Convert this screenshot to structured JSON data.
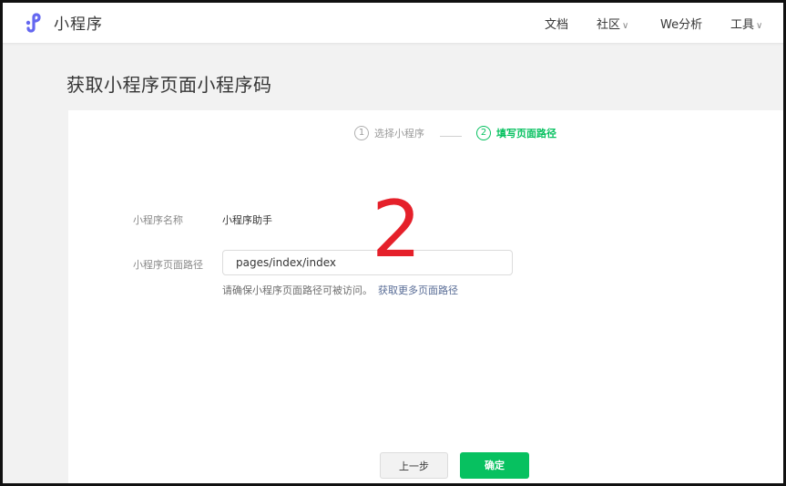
{
  "header": {
    "brand": "小程序",
    "nav": {
      "docs": "文档",
      "community": "社区",
      "analysis": "We分析",
      "tools": "工具"
    }
  },
  "page": {
    "title": "获取小程序页面小程序码"
  },
  "steps": [
    {
      "num": "1",
      "label": "选择小程序",
      "state": "done"
    },
    {
      "num": "2",
      "label": "填写页面路径",
      "state": "active"
    }
  ],
  "form": {
    "name_label": "小程序名称",
    "name_value": "小程序助手",
    "path_label": "小程序页面路径",
    "path_value": "pages/index/index",
    "hint": "请确保小程序页面路径可被访问。",
    "hint_link": "获取更多页面路径"
  },
  "annotation": "2",
  "buttons": {
    "prev": "上一步",
    "confirm": "确定"
  },
  "colors": {
    "accent": "#07c160",
    "link": "#576b95",
    "annotation": "#e5202a"
  },
  "icons": {
    "logo": "miniprogram-logo-icon",
    "dropdown": "chevron-down-icon"
  }
}
